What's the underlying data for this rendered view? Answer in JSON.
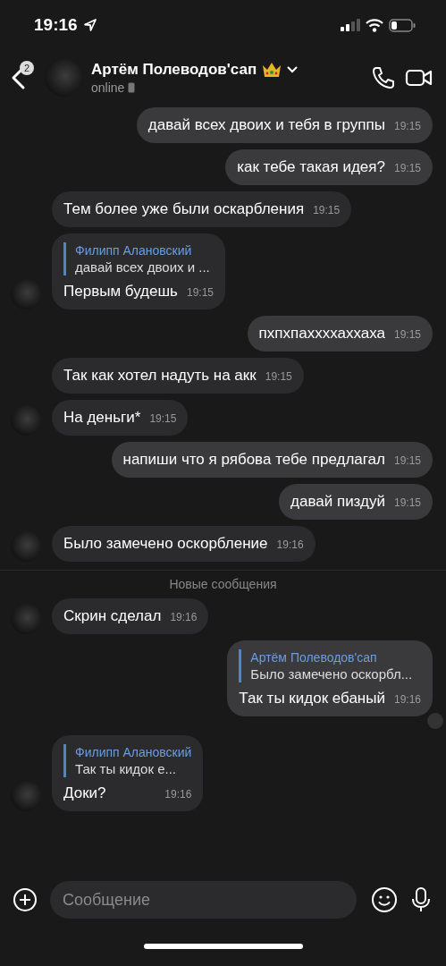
{
  "status_bar": {
    "time": "19:16"
  },
  "header": {
    "back_badge": "2",
    "title": "Артём Полеводов'сап",
    "subtitle": "online"
  },
  "messages": [
    {
      "kind": "outgoing",
      "text": "давай всех двоих и тебя в группы",
      "time": "19:15"
    },
    {
      "kind": "outgoing",
      "text": "как тебе такая идея?",
      "time": "19:15"
    },
    {
      "kind": "incoming",
      "text": "Тем более уже были оскарбления",
      "time": "19:15",
      "avatar": false
    },
    {
      "kind": "incoming",
      "text": "Первым будешь",
      "time": "19:15",
      "avatar": true,
      "reply": {
        "author": "Филипп Алановский",
        "text": "давай всех двоих и ..."
      }
    },
    {
      "kind": "outgoing",
      "text": "пхпхпаххххаххаха",
      "time": "19:15"
    },
    {
      "kind": "incoming",
      "text": "Так как хотел надуть на акк",
      "time": "19:15",
      "avatar": false
    },
    {
      "kind": "incoming",
      "text": "На деньги*",
      "time": "19:15",
      "avatar": true
    },
    {
      "kind": "outgoing",
      "text": "напиши что я рябова тебе предлагал",
      "time": "19:15"
    },
    {
      "kind": "outgoing",
      "text": "давай пиздуй",
      "time": "19:15"
    },
    {
      "kind": "incoming",
      "text": "Было замечено оскорбление",
      "time": "19:16",
      "avatar": true
    },
    {
      "kind": "divider",
      "text": "Новые сообщения"
    },
    {
      "kind": "incoming",
      "text": "Скрин сделал",
      "time": "19:16",
      "avatar": true
    },
    {
      "kind": "outgoing",
      "text": "Так ты кидок ебаный",
      "time": "19:16",
      "read_avatar": true,
      "reply": {
        "author": "Артём Полеводов'сап",
        "text": "Было замечено оскорбл..."
      }
    },
    {
      "kind": "incoming",
      "text": "Доки?",
      "time": "19:16",
      "avatar": true,
      "reply": {
        "author": "Филипп Алановский",
        "text": "Так ты кидок е..."
      }
    }
  ],
  "composer": {
    "placeholder": "Сообщение"
  }
}
